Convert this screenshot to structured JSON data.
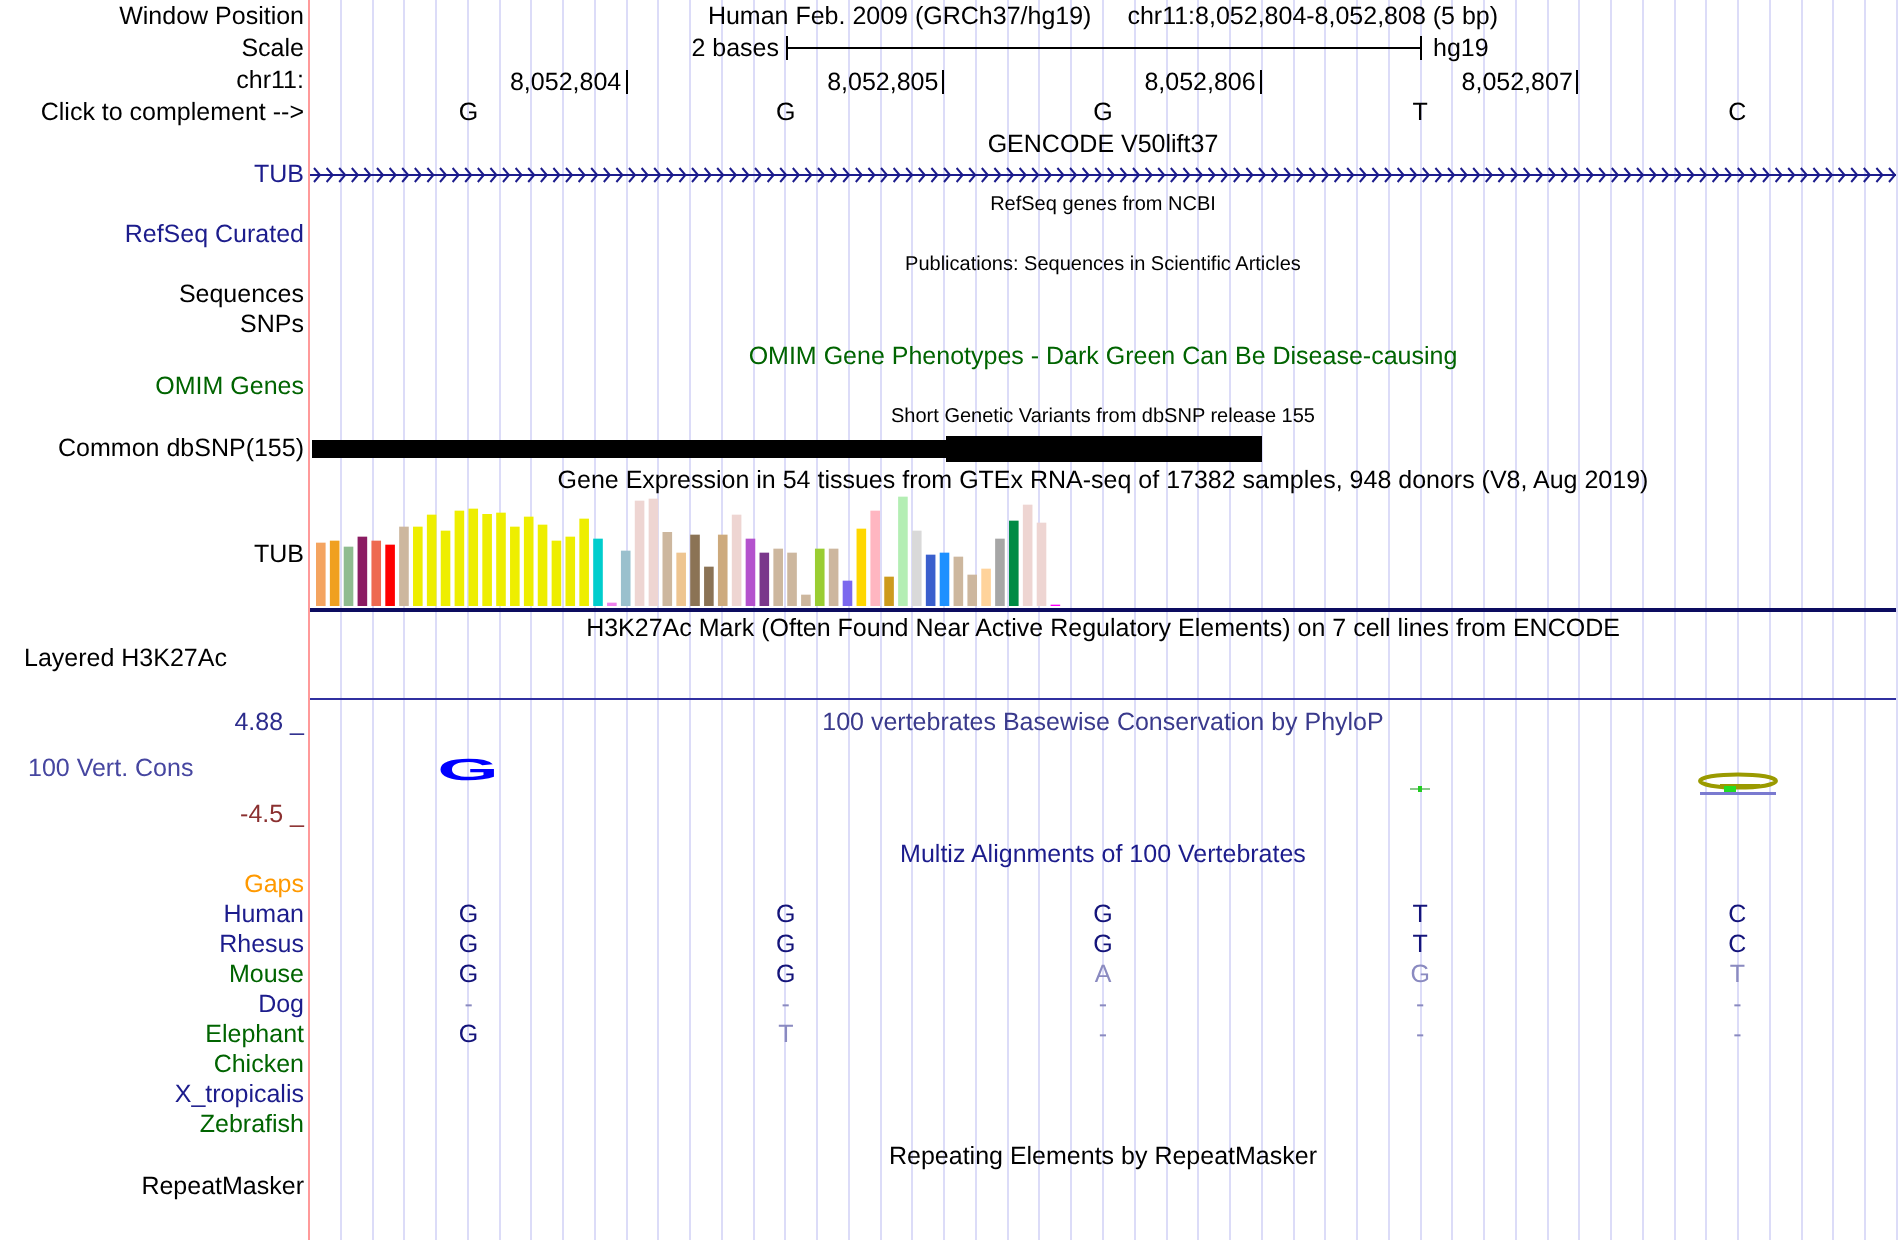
{
  "rows": [
    {
      "kind": "position",
      "label": "Window Position",
      "assembly": "Human Feb. 2009 (GRCh37/hg19)",
      "range": "chr11:8,052,804-8,052,808 (5 bp)"
    },
    {
      "kind": "scale",
      "label": "Scale",
      "span": "2 bases",
      "db": "hg19"
    },
    {
      "kind": "ruler",
      "label": "chr11:",
      "positions": [
        "8,052,804",
        "8,052,805",
        "8,052,806",
        "8,052,807"
      ]
    },
    {
      "kind": "bases",
      "label": "Click to complement -->",
      "bases": [
        "G",
        "G",
        "G",
        "T",
        "C"
      ]
    },
    {
      "kind": "title",
      "title": "GENCODE V50lift37",
      "color": "#000000"
    },
    {
      "kind": "gene",
      "label": "TUB",
      "color": "#1c1c8c"
    },
    {
      "kind": "subtitle",
      "title": "RefSeq genes from NCBI"
    },
    {
      "kind": "label",
      "label": "RefSeq Curated",
      "color": "#1c1c8c"
    },
    {
      "kind": "subtitle",
      "title": "Publications: Sequences in Scientific Articles"
    },
    {
      "kind": "label",
      "label": "Sequences",
      "color": "#000000"
    },
    {
      "kind": "label",
      "label": "SNPs",
      "color": "#000000"
    },
    {
      "kind": "title",
      "title": "OMIM Gene Phenotypes - Dark Green Can Be Disease-causing",
      "color": "#006400"
    },
    {
      "kind": "label",
      "label": "OMIM Genes",
      "color": "#006400"
    },
    {
      "kind": "subtitle",
      "title": "Short Genetic Variants from dbSNP release 155"
    },
    {
      "kind": "snp",
      "label": "Common dbSNP(155)",
      "color": "#000000"
    },
    {
      "kind": "title",
      "title": "Gene Expression in 54 tissues from GTEx RNA-seq of 17382 samples, 948 donors (V8, Aug 2019)",
      "color": "#000000"
    },
    {
      "kind": "expression",
      "label": "TUB",
      "color": "#000000"
    },
    {
      "kind": "title",
      "title": "H3K27Ac Mark (Often Found Near Active Regulatory Elements) on 7 cell lines from ENCODE",
      "color": "#000000"
    },
    {
      "kind": "layered",
      "label": "Layered H3K27Ac",
      "color": "#000000"
    },
    {
      "kind": "conservation",
      "label": "100 Vert. Cons",
      "max": "4.88 _",
      "min": "-4.5 _",
      "title": "100 vertebrates Basewise Conservation by PhyloP",
      "logo": [
        {
          "kind": "letter",
          "letter": "G",
          "color": "#0000ff"
        },
        {
          "kind": "none"
        },
        {
          "kind": "none"
        },
        {
          "kind": "tick"
        },
        {
          "kind": "mark"
        }
      ]
    },
    {
      "kind": "title",
      "title": "Multiz Alignments of 100 Vertebrates",
      "color": "#1c1c8c"
    },
    {
      "kind": "label",
      "label": "Gaps",
      "color": "#ff9900"
    },
    {
      "kind": "species",
      "label": "Human",
      "color": "#1c1c8c",
      "cells": [
        {
          "base": "G",
          "match": true
        },
        {
          "base": "G",
          "match": true
        },
        {
          "base": "G",
          "match": true
        },
        {
          "base": "T",
          "match": true
        },
        {
          "base": "C",
          "match": true
        }
      ]
    },
    {
      "kind": "species",
      "label": "Rhesus",
      "color": "#1c1c8c",
      "cells": [
        {
          "base": "G",
          "match": true
        },
        {
          "base": "G",
          "match": true
        },
        {
          "base": "G",
          "match": true
        },
        {
          "base": "T",
          "match": true
        },
        {
          "base": "C",
          "match": true
        }
      ]
    },
    {
      "kind": "species",
      "label": "Mouse",
      "color": "#006400",
      "cells": [
        {
          "base": "G",
          "match": true
        },
        {
          "base": "G",
          "match": true
        },
        {
          "base": "A",
          "match": false
        },
        {
          "base": "G",
          "match": false
        },
        {
          "base": "T",
          "match": false
        }
      ]
    },
    {
      "kind": "species",
      "label": "Dog",
      "color": "#1c1c8c",
      "cells": [
        {
          "base": "-",
          "match": false
        },
        {
          "base": "-",
          "match": false
        },
        {
          "base": "-",
          "match": false
        },
        {
          "base": "-",
          "match": false
        },
        {
          "base": "-",
          "match": false
        }
      ]
    },
    {
      "kind": "species",
      "label": "Elephant",
      "color": "#006400",
      "cells": [
        {
          "base": "G",
          "match": true
        },
        {
          "base": "T",
          "match": false
        },
        {
          "base": "-",
          "match": false
        },
        {
          "base": "-",
          "match": false
        },
        {
          "base": "-",
          "match": false
        }
      ]
    },
    {
      "kind": "species",
      "label": "Chicken",
      "color": "#006400"
    },
    {
      "kind": "species",
      "label": "X_tropicalis",
      "color": "#1c1c8c"
    },
    {
      "kind": "species",
      "label": "Zebrafish",
      "color": "#006400"
    },
    {
      "kind": "title",
      "title": "Repeating Elements by RepeatMasker",
      "color": "#000000"
    },
    {
      "kind": "label",
      "label": "RepeatMasker",
      "color": "#000000"
    }
  ]
}
